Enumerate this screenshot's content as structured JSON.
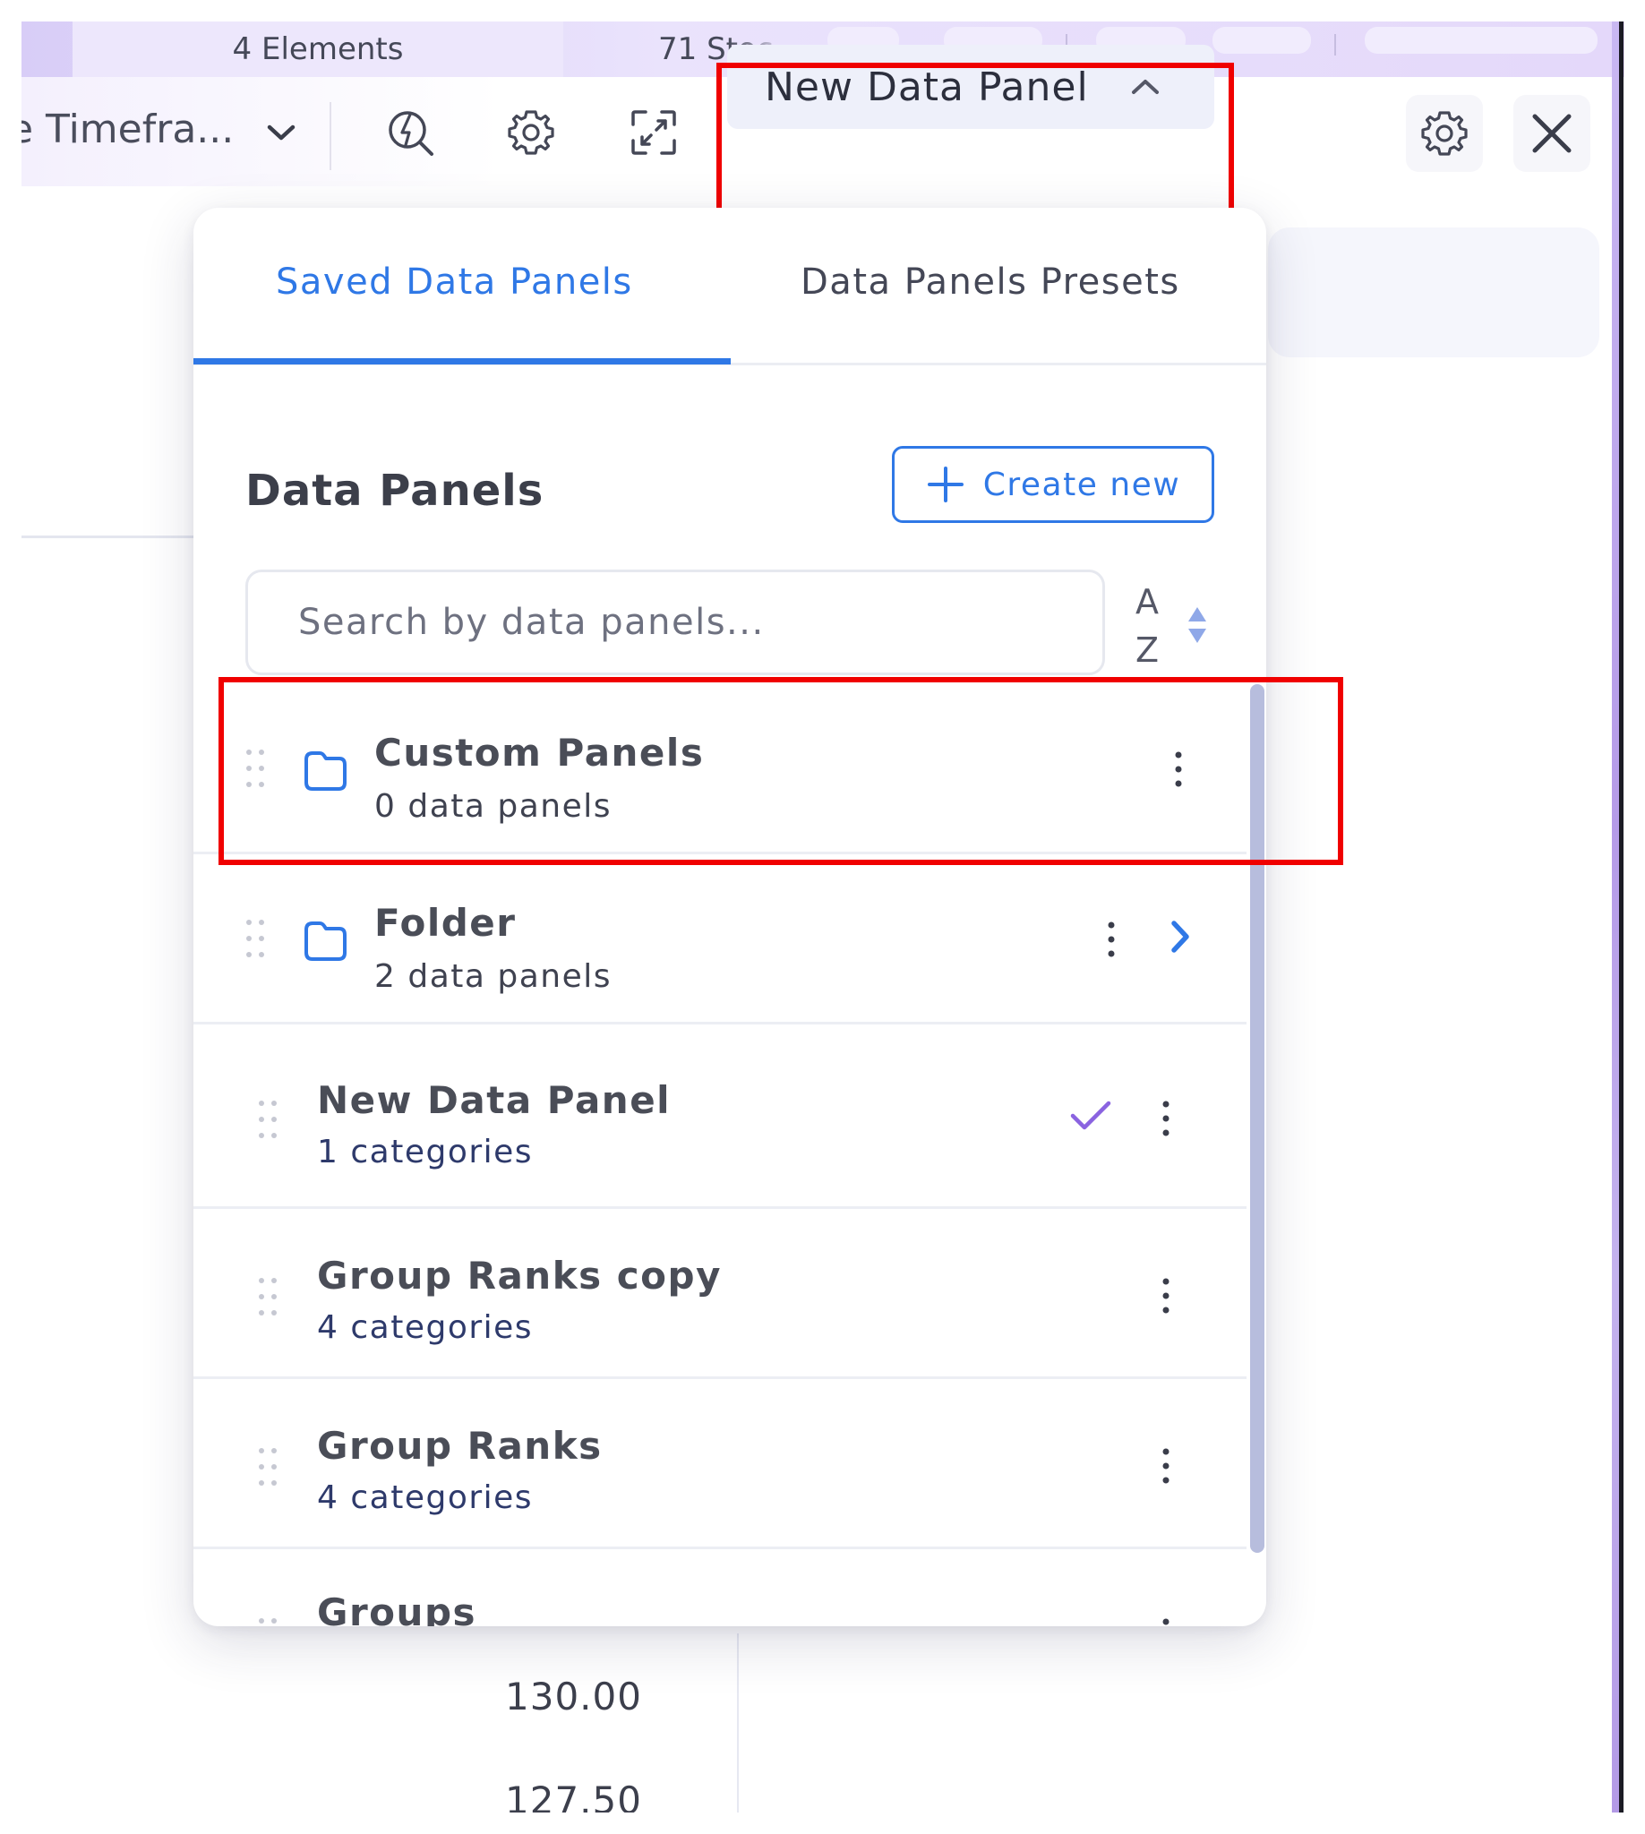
{
  "tabs": [
    {
      "label": "4 Elements"
    },
    {
      "label": "71 Stoc"
    }
  ],
  "toolbar": {
    "timeframe_label": "e Timefra...",
    "data_panel_button": "New Data Panel"
  },
  "dropdown": {
    "tabs": [
      {
        "label": "Saved Data Panels",
        "active": true
      },
      {
        "label": "Data Panels Presets",
        "active": false
      }
    ],
    "heading": "Data Panels",
    "create_button": "Create new",
    "search": {
      "placeholder": "Search by data panels...",
      "value": ""
    },
    "sort": {
      "top": "A",
      "bottom": "Z"
    },
    "folders": [
      {
        "title": "Custom Panels",
        "subtitle": "0 data panels"
      },
      {
        "title": "Folder",
        "subtitle": "2 data panels"
      }
    ],
    "panels": [
      {
        "title": "New Data Panel",
        "subtitle": "1 categories",
        "selected": true
      },
      {
        "title": "Group Ranks copy",
        "subtitle": "4 categories",
        "selected": false
      },
      {
        "title": "Group Ranks",
        "subtitle": "4 categories",
        "selected": false
      },
      {
        "title": "Groups",
        "subtitle": "",
        "selected": false
      }
    ]
  },
  "chart_axis": {
    "price_labels": [
      "130.00",
      "127.50"
    ]
  },
  "colors": {
    "accent": "#2f78e6",
    "selected_check": "#8a63e0",
    "highlight": "#f00000"
  },
  "icons": {
    "toolbar": [
      "chevron-down-icon",
      "alert-search-icon",
      "gear-icon",
      "fullscreen-icon",
      "chevron-up-icon",
      "gear-icon",
      "close-icon"
    ],
    "rows": [
      "drag-handle-icon",
      "folder-icon",
      "kebab-menu-icon",
      "check-icon",
      "chevron-right-icon"
    ],
    "sort": "sort-az-icon"
  }
}
